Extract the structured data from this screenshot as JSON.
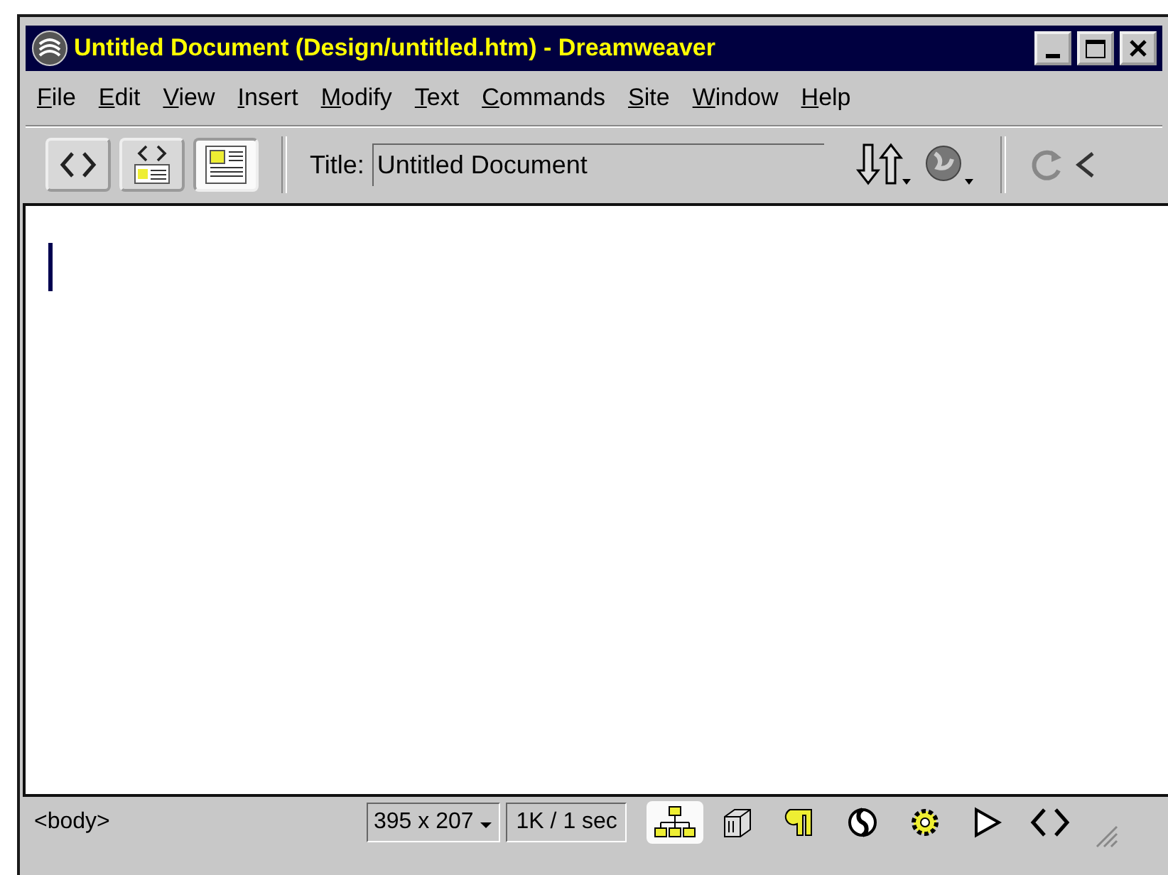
{
  "window": {
    "title": "Untitled Document (Design/untitled.htm) - Dreamweaver"
  },
  "menu": [
    "File",
    "Edit",
    "View",
    "Insert",
    "Modify",
    "Text",
    "Commands",
    "Site",
    "Window",
    "Help"
  ],
  "toolbar": {
    "views": [
      {
        "kind": "code",
        "selected": false
      },
      {
        "kind": "split",
        "selected": false
      },
      {
        "kind": "design",
        "selected": true
      }
    ],
    "title_label": "Title:",
    "title_value": "Untitled Document"
  },
  "status_bar": {
    "tag": "<body>",
    "window_size": "395 x 207",
    "download": "1K / 1 sec",
    "launcher": [
      {
        "kind": "site",
        "selected": true
      },
      {
        "kind": "assets",
        "selected": false
      },
      {
        "kind": "styles",
        "selected": false
      },
      {
        "kind": "css",
        "selected": false
      },
      {
        "kind": "behaviors",
        "selected": false
      },
      {
        "kind": "timelines",
        "selected": false
      },
      {
        "kind": "source",
        "selected": false
      }
    ]
  }
}
